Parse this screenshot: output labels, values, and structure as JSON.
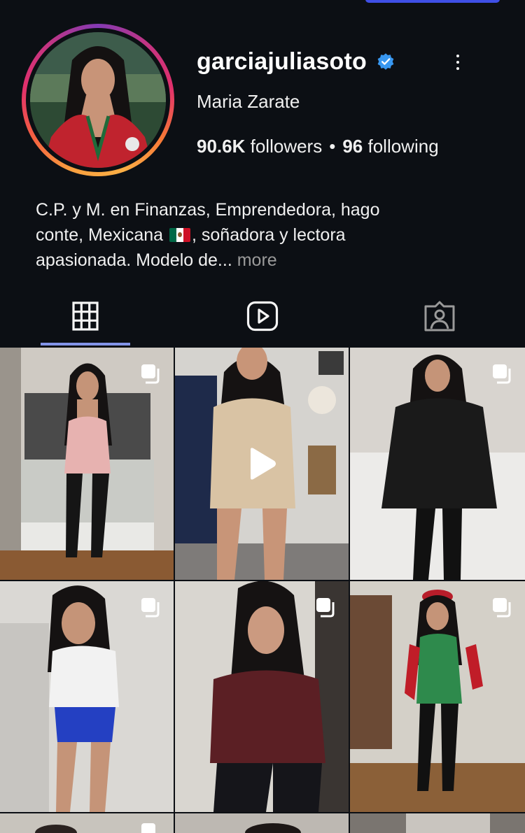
{
  "profile": {
    "username": "garciajuliasoto",
    "full_name": "Maria Zarate",
    "followers_count": "90.6K",
    "followers_label": "followers",
    "separator": "•",
    "following_count": "96",
    "following_label": "following",
    "bio_line_1": "C.P. y M. en Finanzas, Emprendedora, hago",
    "bio_line_2a": "conte, Mexicana ",
    "bio_line_2b": ", soñadora y lectora",
    "bio_line_3": "apasionada. Modelo de...",
    "bio_more": "more",
    "verified": true
  },
  "tabs": [
    {
      "name": "posts-grid",
      "icon": "grid-icon",
      "active": true
    },
    {
      "name": "reels",
      "icon": "reels-icon",
      "active": false
    },
    {
      "name": "tagged",
      "icon": "tagged-person-icon",
      "active": false
    }
  ],
  "posts": [
    {
      "type": "carousel",
      "desc": "pink corset, bedroom"
    },
    {
      "type": "video",
      "desc": "beige dress, living room"
    },
    {
      "type": "carousel",
      "desc": "black blazer and corset"
    },
    {
      "type": "carousel",
      "desc": "cheerleader outfit"
    },
    {
      "type": "carousel",
      "desc": "burgundy top"
    },
    {
      "type": "carousel",
      "desc": "green bodysuit with red beret"
    }
  ],
  "colors": {
    "background": "#0c0f14",
    "verified_badge": "#3897f0",
    "active_tab_underline": "#8fa2ff",
    "muted_text": "#9a9a9a"
  }
}
